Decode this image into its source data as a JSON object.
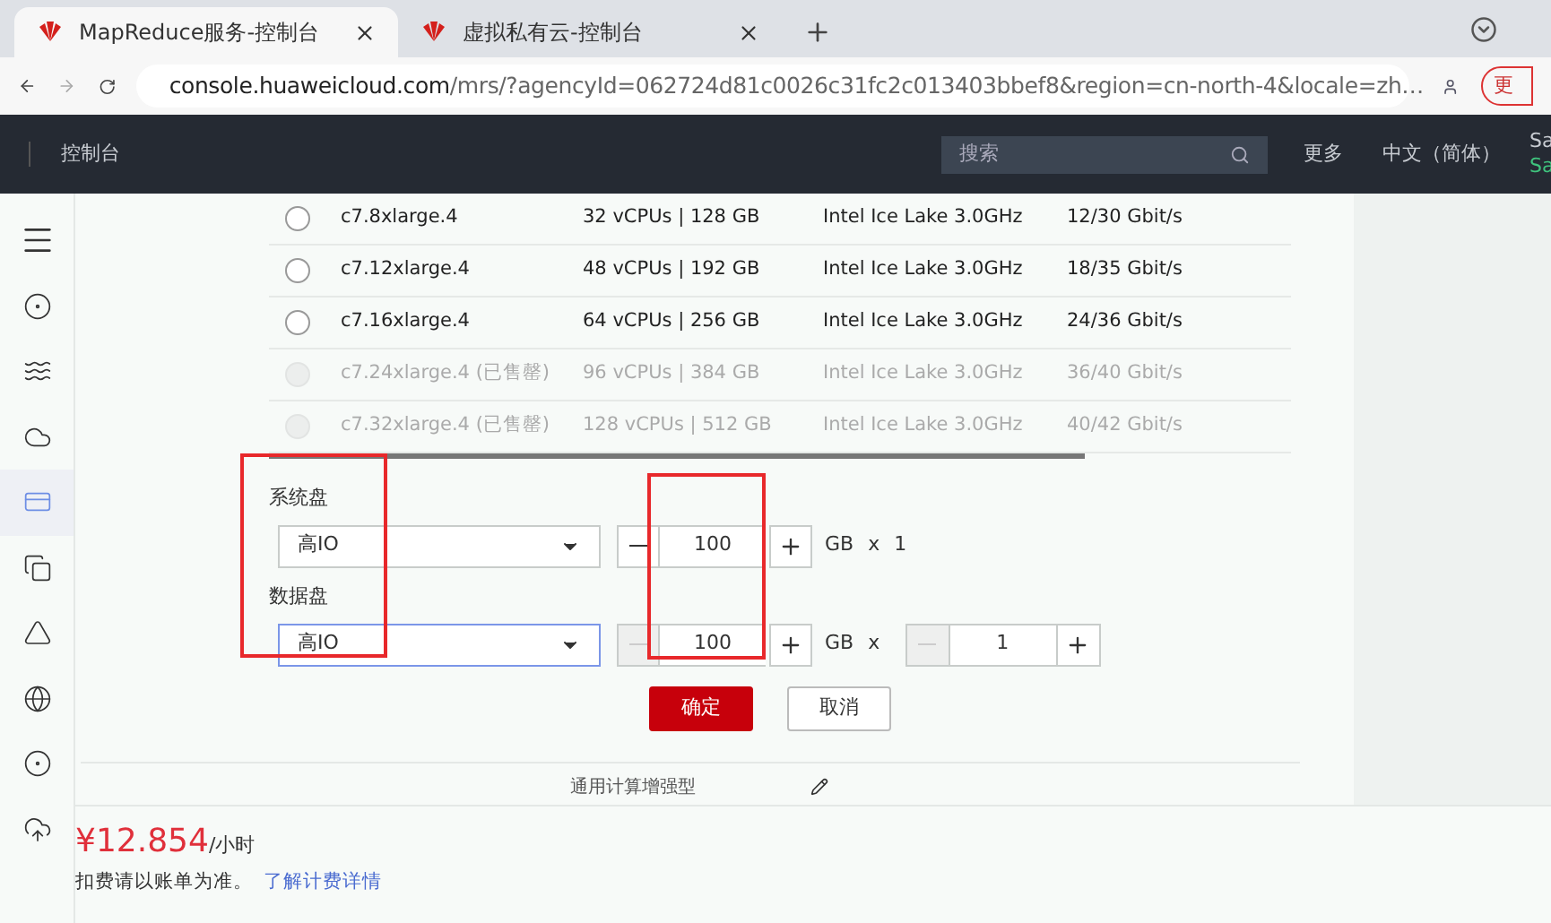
{
  "browser": {
    "tabs": [
      {
        "title": "MapReduce服务-控制台",
        "selected": true
      },
      {
        "title": "虚拟私有云-控制台",
        "selected": false
      }
    ],
    "url_host": "console.huaweicloud.com",
    "url_path": "/mrs/?agencyId=062724d81c0026c31fc2c013403bbef8&region=cn-north-4&locale=zh…",
    "update_button": "更"
  },
  "header": {
    "console": "控制台",
    "search_placeholder": "搜索",
    "more": "更多",
    "language": "中文（简体）",
    "user_line1": "Sa",
    "user_line2": "Sa"
  },
  "sidebar": {
    "items": [
      {
        "kind": "menu",
        "selected": false
      },
      {
        "kind": "circles",
        "selected": false
      },
      {
        "kind": "waves",
        "selected": false
      },
      {
        "kind": "cloud",
        "selected": false
      },
      {
        "kind": "card",
        "selected": true
      },
      {
        "kind": "copy",
        "selected": false
      },
      {
        "kind": "cone",
        "selected": false
      },
      {
        "kind": "globe",
        "selected": false
      },
      {
        "kind": "badge",
        "selected": false
      },
      {
        "kind": "cloud-arrow",
        "selected": false
      }
    ]
  },
  "flavors": [
    {
      "name": "c7.8xlarge.4",
      "cpu_memory": "32 vCPUs | 128 GB",
      "cpu_type": "Intel Ice Lake 3.0GHz",
      "bandwidth": "12/30 Gbit/s",
      "disabled": false,
      "selected": false
    },
    {
      "name": "c7.12xlarge.4",
      "cpu_memory": "48 vCPUs | 192 GB",
      "cpu_type": "Intel Ice Lake 3.0GHz",
      "bandwidth": "18/35 Gbit/s",
      "disabled": false,
      "selected": false
    },
    {
      "name": "c7.16xlarge.4",
      "cpu_memory": "64 vCPUs | 256 GB",
      "cpu_type": "Intel Ice Lake 3.0GHz",
      "bandwidth": "24/36 Gbit/s",
      "disabled": false,
      "selected": false
    },
    {
      "name": "c7.24xlarge.4 (已售罄)",
      "cpu_memory": "96 vCPUs | 384 GB",
      "cpu_type": "Intel Ice Lake 3.0GHz",
      "bandwidth": "36/40 Gbit/s",
      "disabled": true,
      "selected": false
    },
    {
      "name": "c7.32xlarge.4 (已售罄)",
      "cpu_memory": "128 vCPUs | 512 GB",
      "cpu_type": "Intel Ice Lake 3.0GHz",
      "bandwidth": "40/42 Gbit/s",
      "disabled": true,
      "selected": false
    }
  ],
  "disks": [
    {
      "label": "系统盘",
      "type": "高IO",
      "focused": false,
      "size": "100",
      "minus_disabled": false,
      "unit": "GB",
      "times": "x",
      "kind": "text",
      "count": "1"
    },
    {
      "label": "数据盘",
      "type": "高IO",
      "focused": true,
      "size": "100",
      "minus_disabled": true,
      "unit": "GB",
      "times": "x",
      "kind": "stepper",
      "count": "1"
    }
  ],
  "confirm_button": "确定",
  "cancel_button": "取消",
  "section_title": "通用计算增强型",
  "footer": {
    "price": "¥12.854",
    "price_unit": "/小时",
    "note": "扣费请以账单为准。",
    "link": "了解计费详情"
  }
}
